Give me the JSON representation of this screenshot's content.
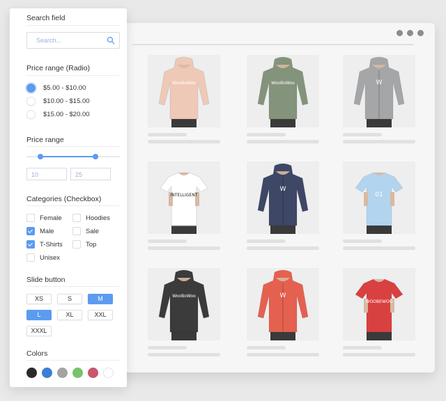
{
  "window": {
    "dots": [
      "dot",
      "dot",
      "dot"
    ]
  },
  "products": [
    {
      "name": "peach-hoodie",
      "color": "#eec9b7",
      "type": "hoodie",
      "print": "WooBoWoo"
    },
    {
      "name": "olive-hoodie",
      "color": "#84937b",
      "type": "hoodie",
      "print": "WooBoWoo"
    },
    {
      "name": "grey-zip-hoodie",
      "color": "#a5a6a8",
      "type": "zip",
      "print": "W"
    },
    {
      "name": "white-tshirt",
      "color": "#ffffff",
      "type": "tee",
      "print": "INTELLIGENT"
    },
    {
      "name": "navy-zip-hoodie",
      "color": "#3e4765",
      "type": "zip",
      "print": "W"
    },
    {
      "name": "lightblue-tshirt",
      "color": "#b3d4ee",
      "type": "tee",
      "print": "01"
    },
    {
      "name": "black-hoodie",
      "color": "#3b3b3b",
      "type": "hoodie",
      "print": "WooBoWoo"
    },
    {
      "name": "red-zip-hoodie",
      "color": "#e4614f",
      "type": "zip",
      "print": "W"
    },
    {
      "name": "red-tshirt",
      "color": "#d94040",
      "type": "tee",
      "print": "WOOBEWOO"
    }
  ],
  "sidebar": {
    "search": {
      "title": "Search field",
      "placeholder": "Search..."
    },
    "price_radio": {
      "title": "Price range (Radio)",
      "options": [
        {
          "label": "$5.00 - $10.00",
          "selected": true
        },
        {
          "label": "$10.00 - $15.00",
          "selected": false
        },
        {
          "label": "$15.00 - $20.00",
          "selected": false
        }
      ]
    },
    "price_range": {
      "title": "Price range",
      "min": "10",
      "max": "25"
    },
    "categories": {
      "title": "Categories (Checkbox)",
      "items": [
        {
          "label": "Female",
          "checked": false
        },
        {
          "label": "Hoodies",
          "checked": false
        },
        {
          "label": "Male",
          "checked": true
        },
        {
          "label": "Sale",
          "checked": false
        },
        {
          "label": "T-Shirts",
          "checked": true
        },
        {
          "label": "Top",
          "checked": false
        },
        {
          "label": "Unisex",
          "checked": false
        }
      ]
    },
    "sizes": {
      "title": "Slide button",
      "items": [
        {
          "label": "XS",
          "selected": false
        },
        {
          "label": "S",
          "selected": false
        },
        {
          "label": "M",
          "selected": true
        },
        {
          "label": "L",
          "selected": true
        },
        {
          "label": "XL",
          "selected": false
        },
        {
          "label": "XXL",
          "selected": false
        },
        {
          "label": "XXXL",
          "selected": false
        }
      ]
    },
    "colors": {
      "title": "Colors",
      "swatches": [
        "#2b2b2b",
        "#3a7fd5",
        "#a3a3a3",
        "#79c26a",
        "#c9566a",
        "#ffffff"
      ]
    }
  }
}
